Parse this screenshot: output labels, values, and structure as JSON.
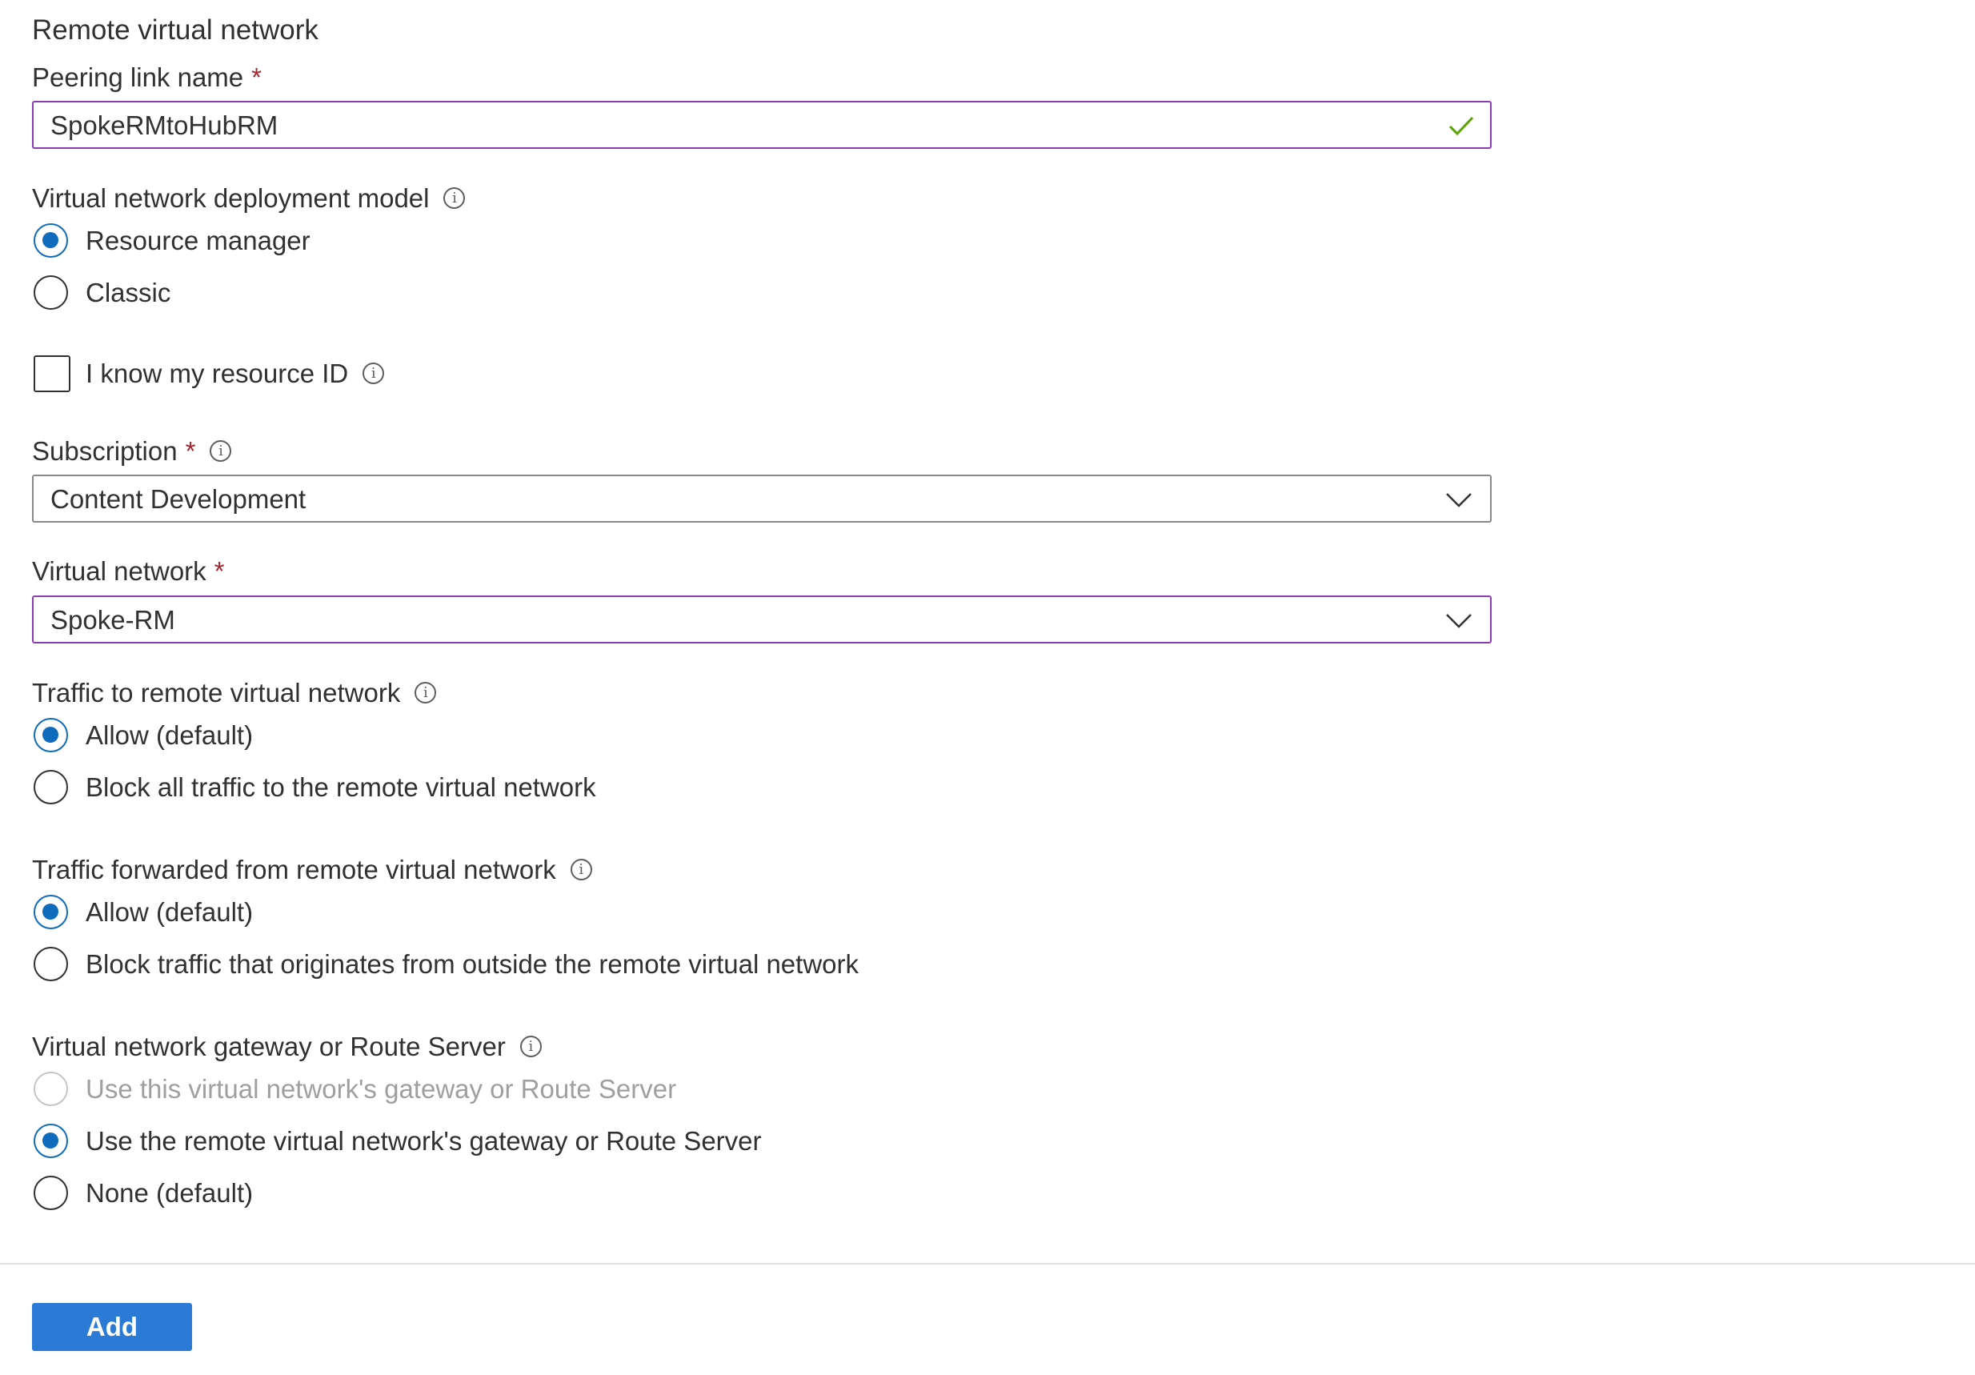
{
  "section_title": "Remote virtual network",
  "peering_link": {
    "label": "Peering link name",
    "required_mark": "*",
    "value": "SpokeRMtoHubRM"
  },
  "deployment_model": {
    "label": "Virtual network deployment model",
    "options": [
      {
        "label": "Resource manager",
        "selected": true
      },
      {
        "label": "Classic",
        "selected": false
      }
    ]
  },
  "resource_id_checkbox": {
    "label": "I know my resource ID",
    "checked": false
  },
  "subscription": {
    "label": "Subscription",
    "required_mark": "*",
    "value": "Content Development"
  },
  "virtual_network": {
    "label": "Virtual network",
    "required_mark": "*",
    "value": "Spoke-RM"
  },
  "traffic_to_remote": {
    "label": "Traffic to remote virtual network",
    "options": [
      {
        "label": "Allow (default)",
        "selected": true
      },
      {
        "label": "Block all traffic to the remote virtual network",
        "selected": false
      }
    ]
  },
  "traffic_forwarded": {
    "label": "Traffic forwarded from remote virtual network",
    "options": [
      {
        "label": "Allow (default)",
        "selected": true
      },
      {
        "label": "Block traffic that originates from outside the remote virtual network",
        "selected": false
      }
    ]
  },
  "gateway": {
    "label": "Virtual network gateway or Route Server",
    "options": [
      {
        "label": "Use this virtual network's gateway or Route Server",
        "selected": false,
        "disabled": true
      },
      {
        "label": "Use the remote virtual network's gateway or Route Server",
        "selected": true
      },
      {
        "label": "None (default)",
        "selected": false
      }
    ]
  },
  "info_icon_glyph": "i",
  "add_button": "Add",
  "colors": {
    "accent": "#0f6cbd",
    "focus_border": "#8e3ab4",
    "required": "#a4262c",
    "valid_check": "#57a300",
    "button_bg": "#2b7bd6"
  }
}
